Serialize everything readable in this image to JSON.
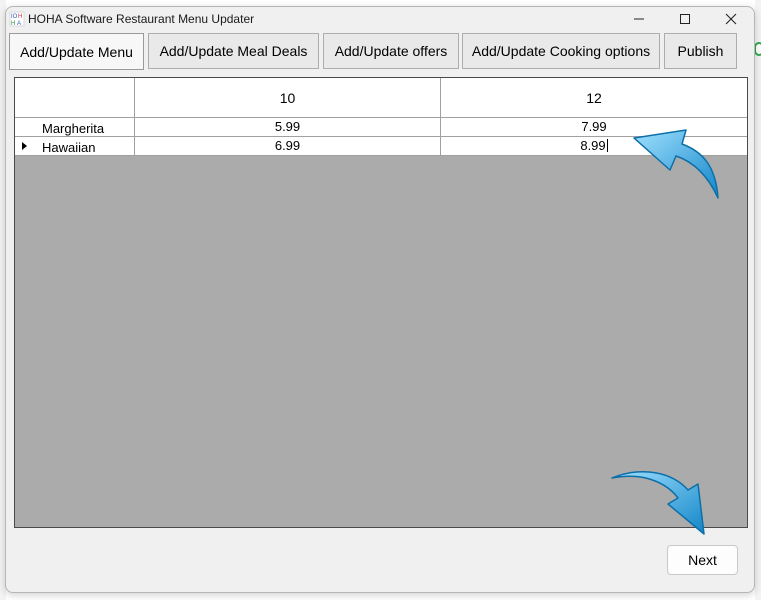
{
  "window": {
    "title": "HOHA Software Restaurant Menu Updater",
    "icon": "hoha-app-icon",
    "controls": [
      "minimize-icon",
      "maximize-icon",
      "close-icon"
    ]
  },
  "tabs": [
    {
      "label": "Add/Update Menu",
      "active": true
    },
    {
      "label": "Add/Update Meal Deals",
      "active": false
    },
    {
      "label": "Add/Update offers",
      "active": false
    },
    {
      "label": "Add/Update Cooking options",
      "active": false
    },
    {
      "label": "Publish",
      "active": false
    }
  ],
  "grid": {
    "columns": [
      "10",
      "12"
    ],
    "rows": [
      {
        "name": "Margherita",
        "values": [
          "5.99",
          "7.99"
        ],
        "current": false
      },
      {
        "name": "Hawaiian",
        "values": [
          "6.99",
          "8.99"
        ],
        "current": true
      }
    ]
  },
  "footer": {
    "next_label": "Next"
  },
  "colors": {
    "grid_background": "#ababab",
    "window_background": "#f0f0f0",
    "arrow_blue": "#29a9e6"
  }
}
